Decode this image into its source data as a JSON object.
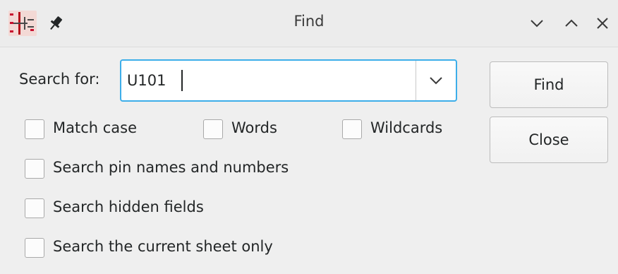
{
  "window": {
    "title": "Find"
  },
  "titlebar": {
    "app_icon": "kicad-schematic-icon",
    "pin_icon": "pin-icon",
    "minimize_icon": "chevron-down-icon",
    "maximize_icon": "chevron-up-icon",
    "close_icon": "close-icon"
  },
  "search": {
    "label": "Search for:",
    "value": "U101",
    "dropdown_icon": "chevron-down-icon"
  },
  "options": {
    "match_case": {
      "label": "Match case",
      "checked": false
    },
    "words": {
      "label": "Words",
      "checked": false
    },
    "wildcards": {
      "label": "Wildcards",
      "checked": false
    },
    "pin_names": {
      "label": "Search pin names and numbers",
      "checked": false
    },
    "hidden_fields": {
      "label": "Search hidden fields",
      "checked": false
    },
    "current_sheet": {
      "label": "Search the current sheet only",
      "checked": false
    }
  },
  "buttons": {
    "find": "Find",
    "close": "Close"
  },
  "colors": {
    "focus_border": "#3daee9",
    "background": "#efefef",
    "app_icon_red": "#c8102e"
  }
}
